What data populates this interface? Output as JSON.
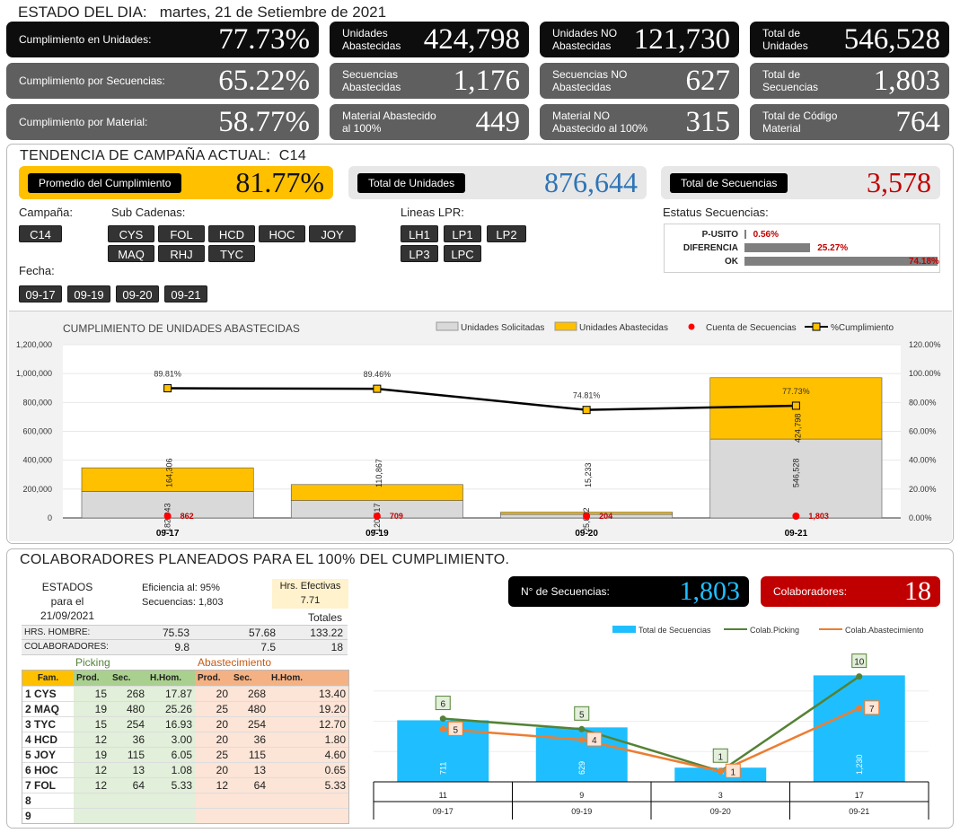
{
  "header": {
    "label": "ESTADO DEL DIA:",
    "date": "martes, 21 de Setiembre de 2021"
  },
  "cards": [
    {
      "label": "Cumplimiento en Unidades:",
      "value": "77.73%"
    },
    {
      "label": "Unidades\nAbastecidas",
      "value": "424,798"
    },
    {
      "label": "Unidades NO\nAbastecidas",
      "value": "121,730"
    },
    {
      "label": "Total de\nUnidades",
      "value": "546,528"
    },
    {
      "label": "Cumplimiento por Secuencias:",
      "value": "65.22%"
    },
    {
      "label": "Secuencias\nAbastecidas",
      "value": "1,176"
    },
    {
      "label": "Secuencias NO\nAbastecidas",
      "value": "627"
    },
    {
      "label": "Total de\nSecuencias",
      "value": "1,803"
    },
    {
      "label": "Cumplimiento por Material:",
      "value": "58.77%"
    },
    {
      "label": "Material Abastecido\nal 100%",
      "value": "449"
    },
    {
      "label": "Material NO\nAbastecido al 100%",
      "value": "315"
    },
    {
      "label": "Total de Código\nMaterial",
      "value": "764"
    }
  ],
  "trend": {
    "title": "TENDENCIA DE CAMPAÑA ACTUAL:",
    "campaign": "C14",
    "avg_label": "Promedio  del Cumplimiento",
    "avg_value": "81.77%",
    "units_label": "Total de Unidades",
    "units_value": "876,644",
    "seq_label": "Total de Secuencias",
    "seq_value": "3,578",
    "colors": {
      "avg_bg": "#ffc000",
      "units_val": "#2e75b6",
      "seq_val": "#c00000"
    }
  },
  "slicers": {
    "campana_label": "Campaña:",
    "campana": [
      "C14"
    ],
    "sub_label": "Sub Cadenas:",
    "sub": [
      "CYS",
      "FOL",
      "HCD",
      "HOC",
      "JOY",
      "MAQ",
      "RHJ",
      "TYC"
    ],
    "lpr_label": "Lineas LPR:",
    "lpr": [
      "LH1",
      "LP1",
      "LP2",
      "LP3",
      "LPC"
    ],
    "fecha_label": "Fecha:",
    "fecha": [
      "09-17",
      "09-19",
      "09-20",
      "09-21"
    ]
  },
  "estatus": {
    "label": "Estatus Secuencias:",
    "rows": [
      {
        "name": "P-USITO",
        "pct": "0.56%",
        "value": 0.56
      },
      {
        "name": "DIFERENCIA",
        "pct": "25.27%",
        "value": 25.27
      },
      {
        "name": "OK",
        "pct": "74.18%",
        "value": 74.18
      }
    ]
  },
  "chart_data": [
    {
      "type": "bar",
      "title": "CUMPLIMIENTO DE UNIDADES ABASTECIDAS",
      "legend": [
        "Unidades Solicitadas",
        "Unidades Abastecidas",
        "Cuenta de Secuencias",
        "%Cumplimiento"
      ],
      "categories": [
        "09-17",
        "09-19",
        "09-20",
        "09-21"
      ],
      "series": [
        {
          "name": "Unidades Solicitadas",
          "values": [
            182943,
            120517,
            25022,
            546528
          ],
          "labels": [
            "182,943",
            "120,517",
            "25,022",
            "546,528"
          ]
        },
        {
          "name": "Unidades Abastecidas",
          "values": [
            164306,
            110867,
            15233,
            424798
          ],
          "labels": [
            "164,306",
            "110,867",
            "15,233",
            "424,798"
          ]
        },
        {
          "name": "Cuenta de Secuencias",
          "values": [
            862,
            709,
            204,
            1803
          ],
          "labels": [
            "862",
            "709",
            "204",
            "1,803"
          ]
        },
        {
          "name": "%Cumplimiento",
          "values": [
            89.81,
            89.46,
            74.81,
            77.73
          ],
          "labels": [
            "89.81%",
            "89.46%",
            "74.81%",
            "77.73%"
          ]
        }
      ],
      "y_ticks": [
        "0",
        "200,000",
        "400,000",
        "600,000",
        "800,000",
        "1,000,000",
        "1,200,000"
      ],
      "y2_ticks": [
        "0.00%",
        "20.00%",
        "40.00%",
        "60.00%",
        "80.00%",
        "100.00%",
        "120.00%"
      ],
      "ylim": [
        0,
        1200000
      ],
      "y2lim": [
        0,
        120
      ],
      "colors": {
        "solicitadas": "#d9d9d9",
        "abastecidas": "#ffc000",
        "secuencias": "#ff0000",
        "cumplimiento": "#000000"
      }
    },
    {
      "type": "bar",
      "legend": [
        "Total de Secuencias",
        "Colab.Picking",
        "Colab.Abastecimiento"
      ],
      "categories": [
        "09-17",
        "09-19",
        "09-20",
        "09-21"
      ],
      "top_labels": [
        "11",
        "9",
        "3",
        "17"
      ],
      "series": [
        {
          "name": "Total de Secuencias",
          "values": [
            711,
            629,
            164,
            1230
          ],
          "labels": [
            "711",
            "629",
            "164",
            "1,230"
          ]
        },
        {
          "name": "Colab.Picking",
          "values": [
            6,
            5,
            1,
            10
          ]
        },
        {
          "name": "Colab.Abastecimiento",
          "values": [
            5,
            4,
            1,
            7
          ]
        }
      ],
      "colors": {
        "bars": "#1fbfff",
        "picking": "#548235",
        "abast": "#ed7d31"
      }
    }
  ],
  "colab": {
    "title": "COLABORADORES PLANEADOS PARA EL 100% DEL CUMPLIMIENTO.",
    "estados": [
      "ESTADOS",
      "para el",
      "21/09/2021"
    ],
    "eficiencia_label": "Eficiencia al:",
    "eficiencia": "95%",
    "secuencias_label": "Secuencias:",
    "secuencias": "1,803",
    "hrs_ef_label": "Hrs. Efectivas",
    "hrs_ef": "7.71",
    "totales_label": "Totales",
    "hrs_hombre_label": "HRS. HOMBRE:",
    "hrs_hombre": [
      "75.53",
      "57.68",
      "133.22"
    ],
    "colab_label": "COLABORADORES:",
    "colab_vals": [
      "9.8",
      "7.5",
      "18"
    ],
    "picking_label": "Picking",
    "abast_label": "Abastecimiento",
    "col_headers": [
      "Fam.",
      "Prod.",
      "Sec.",
      "H.Hom.",
      "Prod.",
      "Sec.",
      "H.Hom."
    ],
    "rows": [
      [
        "1",
        "CYS",
        "15",
        "268",
        "17.87",
        "20",
        "268",
        "13.40"
      ],
      [
        "2",
        "MAQ",
        "19",
        "480",
        "25.26",
        "25",
        "480",
        "19.20"
      ],
      [
        "3",
        "TYC",
        "15",
        "254",
        "16.93",
        "20",
        "254",
        "12.70"
      ],
      [
        "4",
        "HCD",
        "12",
        "36",
        "3.00",
        "20",
        "36",
        "1.80"
      ],
      [
        "5",
        "JOY",
        "19",
        "115",
        "6.05",
        "25",
        "115",
        "4.60"
      ],
      [
        "6",
        "HOC",
        "12",
        "13",
        "1.08",
        "20",
        "13",
        "0.65"
      ],
      [
        "7",
        "FOL",
        "12",
        "64",
        "5.33",
        "12",
        "64",
        "5.33"
      ],
      [
        "8",
        "",
        "",
        "",
        "",
        "",
        "",
        ""
      ],
      [
        "9",
        "",
        "",
        "",
        "",
        "",
        "",
        ""
      ]
    ],
    "nsec_label": "N° de Secuencias:",
    "nsec_value": "1,803",
    "ncol_label": "Colaboradores:",
    "ncol_value": "18"
  }
}
